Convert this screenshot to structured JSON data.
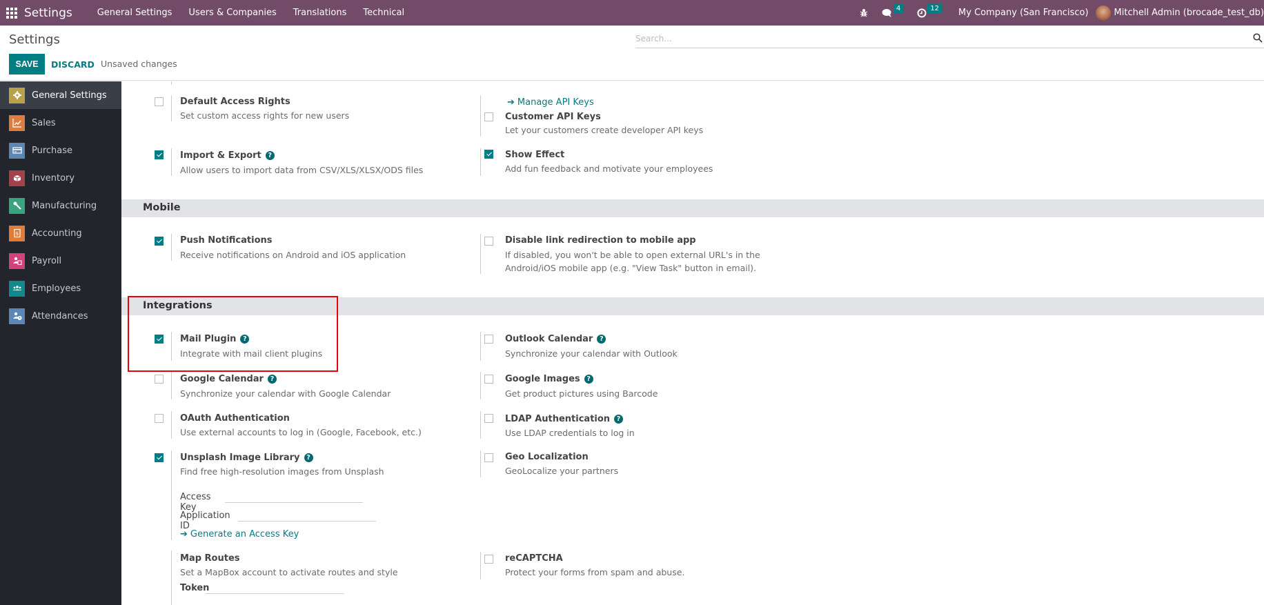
{
  "navbar": {
    "brand": "Settings",
    "menu": [
      "General Settings",
      "Users & Companies",
      "Translations",
      "Technical"
    ],
    "messages_count": "4",
    "activities_count": "12",
    "company": "My Company (San Francisco)",
    "user": "Mitchell Admin (brocade_test_db)"
  },
  "control": {
    "title": "Settings",
    "save_label": "SAVE",
    "discard_label": "DISCARD",
    "status": "Unsaved changes",
    "search_placeholder": "Search..."
  },
  "sidebar": {
    "items": [
      {
        "label": "General Settings",
        "icon": "gear-icon",
        "color": "#b8a14a",
        "active": true
      },
      {
        "label": "Sales",
        "icon": "chart-icon",
        "color": "#de7b3e"
      },
      {
        "label": "Purchase",
        "icon": "credit-card-icon",
        "color": "#5d86b5"
      },
      {
        "label": "Inventory",
        "icon": "box-icon",
        "color": "#a5404d"
      },
      {
        "label": "Manufacturing",
        "icon": "wrench-icon",
        "color": "#3aa47f"
      },
      {
        "label": "Accounting",
        "icon": "invoice-icon",
        "color": "#e07b38"
      },
      {
        "label": "Payroll",
        "icon": "payroll-icon",
        "color": "#d2427b"
      },
      {
        "label": "Employees",
        "icon": "users-icon",
        "color": "#118a8a"
      },
      {
        "label": "Attendances",
        "icon": "attendance-icon",
        "color": "#5b87b8"
      }
    ]
  },
  "sections": {
    "top": {
      "default_access": {
        "title": "Default Access Rights",
        "desc": "Set custom access rights for new users",
        "checked": false
      },
      "manage_api_link": "Manage API Keys",
      "customer_api": {
        "title": "Customer API Keys",
        "desc": "Let your customers create developer API keys",
        "checked": false
      },
      "import_export": {
        "title": "Import & Export",
        "desc": "Allow users to import data from CSV/XLS/XLSX/ODS files",
        "checked": true
      },
      "show_effect": {
        "title": "Show Effect",
        "desc": "Add fun feedback and motivate your employees",
        "checked": true
      }
    },
    "mobile": {
      "title": "Mobile",
      "push": {
        "title": "Push Notifications",
        "desc": "Receive notifications on Android and iOS application",
        "checked": true
      },
      "disable_link": {
        "title": "Disable link redirection to mobile app",
        "desc1": "If disabled, you won't be able to open external URL's in the",
        "desc2": "Android/iOS mobile app (e.g. \"View Task\" button in email).",
        "checked": false
      }
    },
    "integrations": {
      "title": "Integrations",
      "mail_plugin": {
        "title": "Mail Plugin",
        "desc": "Integrate with mail client plugins",
        "checked": true
      },
      "outlook": {
        "title": "Outlook Calendar",
        "desc": "Synchronize your calendar with Outlook",
        "checked": false
      },
      "google_calendar": {
        "title": "Google Calendar",
        "desc": "Synchronize your calendar with Google Calendar",
        "checked": false
      },
      "google_images": {
        "title": "Google Images",
        "desc": "Get product pictures using Barcode",
        "checked": false
      },
      "oauth": {
        "title": "OAuth Authentication",
        "desc": "Use external accounts to log in (Google, Facebook, etc.)",
        "checked": false
      },
      "ldap": {
        "title": "LDAP Authentication",
        "desc": "Use LDAP credentials to log in",
        "checked": false
      },
      "unsplash": {
        "title": "Unsplash Image Library",
        "desc": "Find free high-resolution images from Unsplash",
        "checked": true,
        "access_key_label": "Access Key",
        "access_key_value": "",
        "app_id_label": "Application ID",
        "app_id_value": "",
        "generate_link": "Generate an Access Key"
      },
      "geo": {
        "title": "Geo Localization",
        "desc": "GeoLocalize your partners",
        "checked": false
      },
      "map_routes": {
        "title": "Map Routes",
        "desc": "Set a MapBox account to activate routes and style",
        "token_label": "Token",
        "token_value": ""
      },
      "recaptcha": {
        "title": "reCAPTCHA",
        "desc": "Protect your forms from spam and abuse.",
        "checked": false
      }
    }
  },
  "colors": {
    "navbar": "#714b67",
    "primary": "#017e84",
    "highlight": "#e8000b"
  }
}
